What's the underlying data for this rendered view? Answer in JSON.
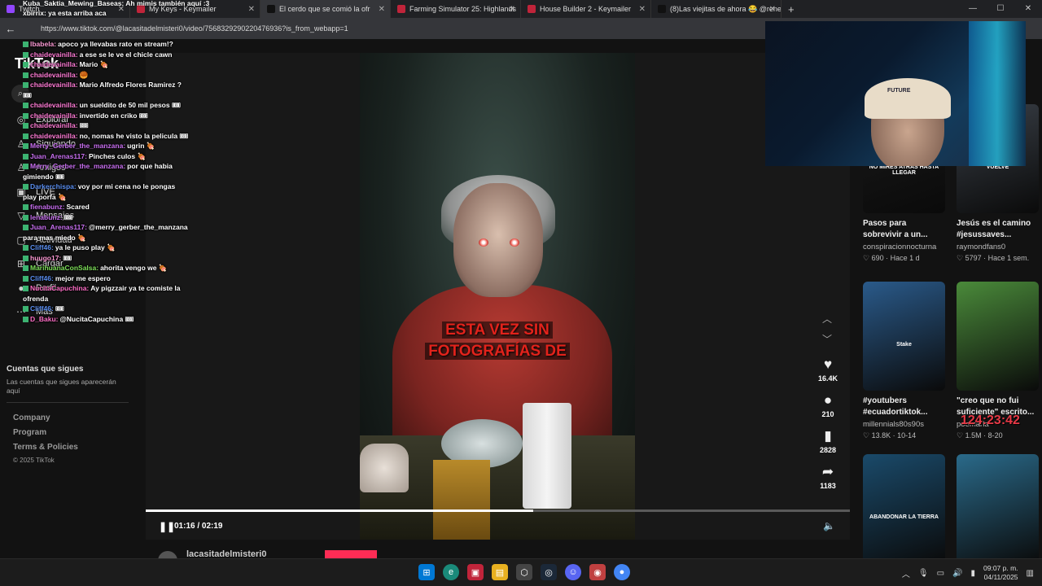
{
  "browser": {
    "tabs": [
      {
        "label": "Twitch",
        "icon": "twitch-icon",
        "color": "#9146ff"
      },
      {
        "label": "My Keys - Keymailer",
        "icon": "keymailer-icon",
        "color": "#c0243a"
      },
      {
        "label": "El cerdo que se comió la ofr",
        "icon": "tiktok-icon",
        "color": "#111111",
        "active": true
      },
      {
        "label": "Farming Simulator 25: Highlands",
        "icon": "keymailer-icon",
        "color": "#c0243a"
      },
      {
        "label": "House Builder 2 - Keymailer",
        "icon": "keymailer-icon",
        "color": "#c0243a"
      },
      {
        "label": "(8)Las viejitas de ahora 😂 @rene",
        "icon": "tiktok-icon",
        "color": "#111111"
      }
    ],
    "url": "https://www.tiktok.com/@lacasitadelmisteri0/video/7568329290220476936?is_from_webapp=1"
  },
  "sidebar": {
    "logo": "TikTok",
    "nav": [
      {
        "label": "Explorar",
        "icon": "compass-icon"
      },
      {
        "label": "Siguiendo",
        "icon": "following-icon"
      },
      {
        "label": "Amigos",
        "icon": "friends-icon"
      },
      {
        "label": "LIVE",
        "icon": "live-icon"
      },
      {
        "label": "Mensajes",
        "icon": "messages-icon"
      },
      {
        "label": "Actividad",
        "icon": "inbox-icon"
      },
      {
        "label": "Cargar",
        "icon": "upload-icon"
      },
      {
        "label": "Perfil",
        "icon": "profile-icon"
      },
      {
        "label": "Más",
        "icon": "more-icon"
      }
    ],
    "following_title": "Cuentas que sigues",
    "following_sub": "Las cuentas que sigues aparecerán aquí",
    "footer": [
      "Company",
      "Program",
      "Terms & Policies"
    ],
    "copyright": "© 2025 TikTok"
  },
  "chat_top": [
    "Kuba_Saktia_Mewing_Baseas: Ah mimis también aquí :3",
    "xbirrix: ya esta arriba aca"
  ],
  "chat": [
    {
      "user": "lbabela:",
      "text": "apoco ya llevabas rato en stream!?",
      "color": "#ff9ad5"
    },
    {
      "user": "chaidevainilla:",
      "text": "a ese se le ve el chicle cawn",
      "color": "#ff7bd5"
    },
    {
      "user": "chaidevainilla:",
      "text": "Mario 🍖",
      "color": "#ff7bd5"
    },
    {
      "user": "chaidevainilla:",
      "text": "🥮",
      "color": "#ff7bd5"
    },
    {
      "user": "chaidevainilla:",
      "text": "Mario Alfredo Flores Ramirez ? 🎟",
      "color": "#ff7bd5"
    },
    {
      "user": "chaidevainilla:",
      "text": "un sueldito de 50 mil pesos 🎟",
      "color": "#ff7bd5"
    },
    {
      "user": "chaidevainilla:",
      "text": "invertido en criko 🎟",
      "color": "#ff7bd5"
    },
    {
      "user": "chaidevainilla:",
      "text": "🎟",
      "color": "#ff7bd5"
    },
    {
      "user": "chaidevainilla:",
      "text": "no, nomas he visto la pelicula 🎟",
      "color": "#ff7bd5"
    },
    {
      "user": "Merry_Gerber_the_manzana:",
      "text": "ugrin 🍖",
      "color": "#c86ff0"
    },
    {
      "user": "Juan_Arenas117:",
      "text": "Pinches culos 🍖",
      "color": "#c86ff0"
    },
    {
      "user": "Merry_Gerber_the_manzana:",
      "text": "por que habia gimiendo 🎟",
      "color": "#c86ff0"
    },
    {
      "user": "Darkerchispa:",
      "text": "voy por mi cena no le pongas play porfa 🍖",
      "color": "#5a8ef0"
    },
    {
      "user": "fienabunz:",
      "text": "Scared",
      "color": "#c86ff0"
    },
    {
      "user": "lenabunz:",
      "text": "🎟",
      "color": "#c86ff0"
    },
    {
      "user": "Juan_Arenas117:",
      "text": "@merry_gerber_the_manzana para mas miedo 🍖",
      "color": "#c86ff0"
    },
    {
      "user": "Cliff46:",
      "text": "ya le puso play 🍖",
      "color": "#5a8ef0"
    },
    {
      "user": "huugo17:",
      "text": "🎟",
      "color": "#ff9ad5"
    },
    {
      "user": "MarihuanaConSalsa:",
      "text": "ahorita vengo we 🍖",
      "color": "#7ee05a"
    },
    {
      "user": "Cliff46:",
      "text": "mejor me espero",
      "color": "#5a8ef0"
    },
    {
      "user": "NucitaCapuchina:",
      "text": "Ay pigzzair ya te comiste la ofrenda",
      "color": "#ff6ec7"
    },
    {
      "user": "Cliff46:",
      "text": "🎟",
      "color": "#5a8ef0"
    },
    {
      "user": "D_Baku:",
      "text": "@NucitaCapuchina 🎟",
      "color": "#ff6ec7"
    }
  ],
  "video": {
    "caption_line1": "ESTA VEZ SIN",
    "caption_line2": "FOTOGRAFÍAS DE",
    "time": "01:16 / 02:19",
    "progress": 0.55,
    "author": "lacasitadelmisteri0"
  },
  "actions": [
    {
      "icon": "heart-icon",
      "count": "16.4K"
    },
    {
      "icon": "comment-icon",
      "count": "210"
    },
    {
      "icon": "bookmark-icon",
      "count": "2828"
    },
    {
      "icon": "share-icon",
      "count": "1183"
    }
  ],
  "recommendations": [
    {
      "title": "Pasos para sobrevivir a un...",
      "user": "conspiracionnocturna",
      "likes": "690",
      "age": "Hace 1 d",
      "thumb_text": "NO MIRES ATRAS HASTA LLEGAR",
      "color": "#1a1a1a"
    },
    {
      "title": "Jesús es el camino #jesussaves...",
      "user": "raymondfans0",
      "likes": "5797",
      "age": "Hace 1 sem.",
      "thumb_text": "VUELVE",
      "color": "#3a4048"
    },
    {
      "title": "#youtubers #ecuadortiktok...",
      "user": "millennials80s90s",
      "likes": "13.8K",
      "age": "10-14",
      "thumb_text": "Stake",
      "color": "#2a5a8a"
    },
    {
      "title": "\"creo que no fui suficiente\" escrito...",
      "user": "poemarla",
      "likes": "1.5M",
      "age": "8-20",
      "thumb_text": "",
      "color": "#4a8a3a"
    },
    {
      "title": "",
      "user": "",
      "likes": "",
      "age": "",
      "thumb_text": "ABANDONAR LA TIERRA",
      "color": "#1a4a6a"
    },
    {
      "title": "",
      "user": "",
      "likes": "",
      "age": "",
      "thumb_text": "",
      "color": "#2a6a8a"
    }
  ],
  "overlay": {
    "timer": "124:23:42",
    "webcam_label": "FUTURE"
  },
  "taskbar": {
    "time": "09:07 p. m.",
    "date": "04/11/2025"
  }
}
